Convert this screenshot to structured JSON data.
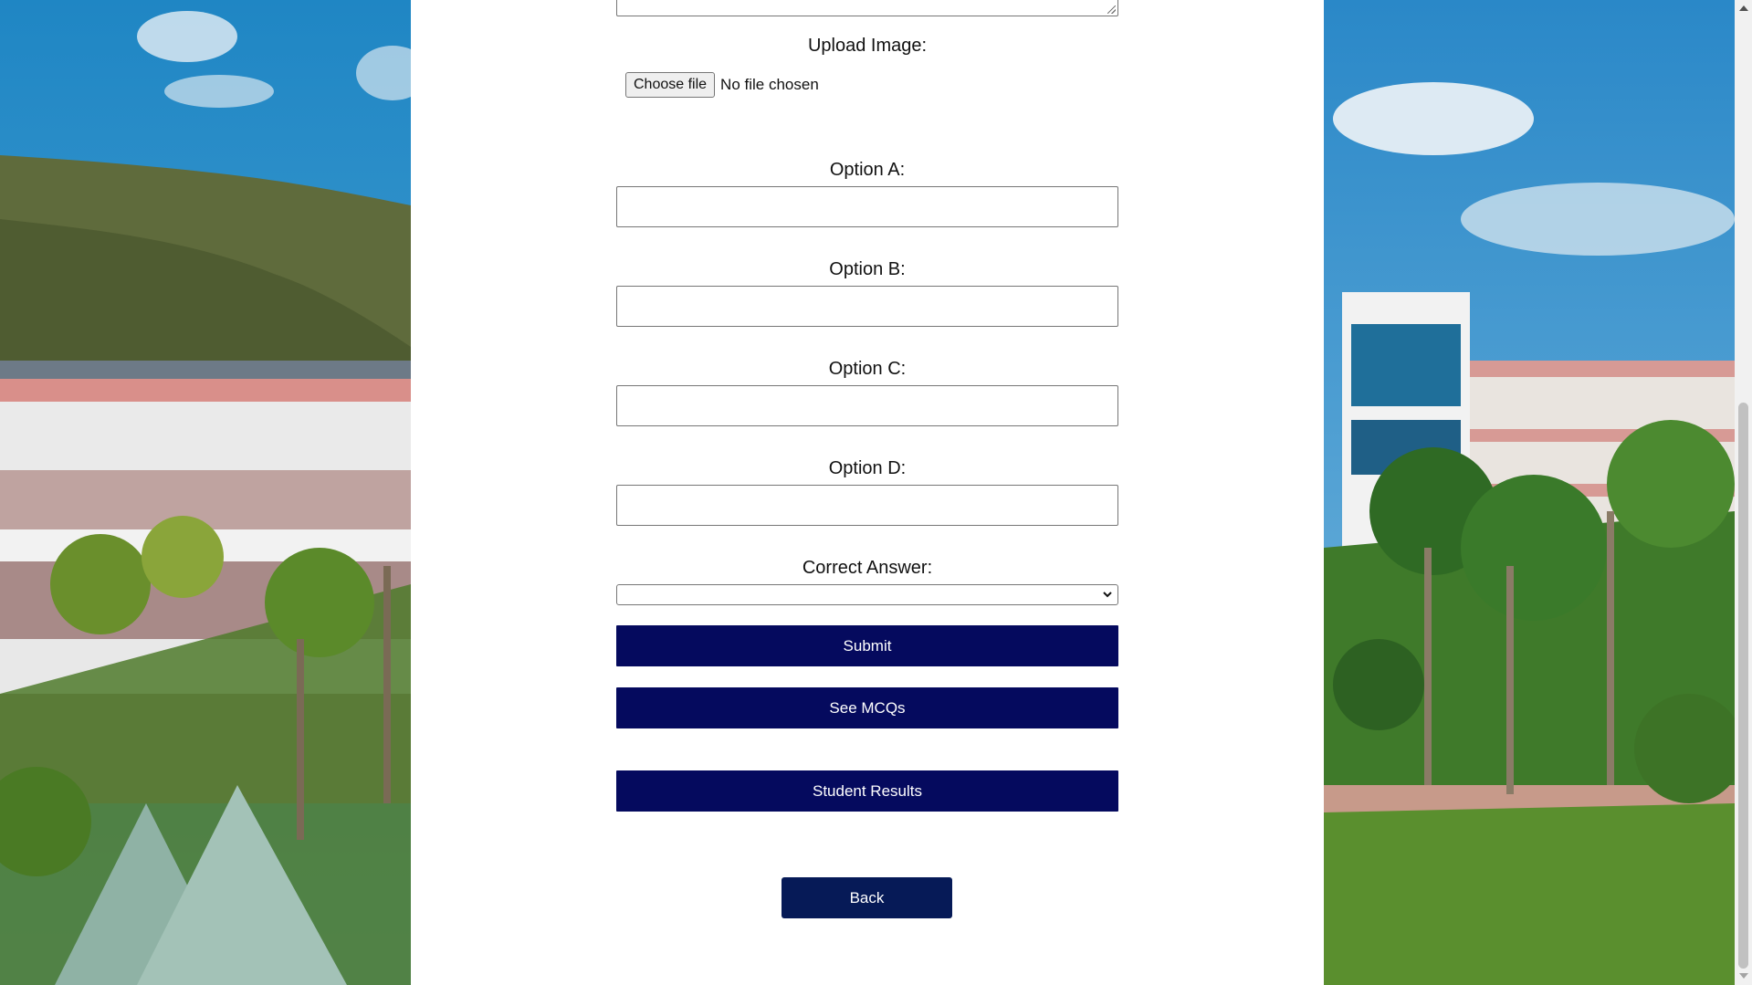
{
  "form": {
    "upload_label": "Upload Image:",
    "choose_file_label": "Choose file",
    "file_status": "No file chosen",
    "options": [
      {
        "label": "Option A:",
        "value": ""
      },
      {
        "label": "Option B:",
        "value": ""
      },
      {
        "label": "Option C:",
        "value": ""
      },
      {
        "label": "Option D:",
        "value": ""
      }
    ],
    "correct_answer_label": "Correct Answer:",
    "correct_answer_value": ""
  },
  "buttons": {
    "submit": "Submit",
    "see_mcqs": "See MCQs",
    "student_results": "Student Results",
    "back": "Back"
  },
  "colors": {
    "button_bg": "#050a5e",
    "back_bg": "#061a57",
    "panel_bg": "#ffffff"
  },
  "background": {
    "left_scene": "campus-building-with-hill",
    "right_scene": "campus-courtyard-with-palms"
  }
}
